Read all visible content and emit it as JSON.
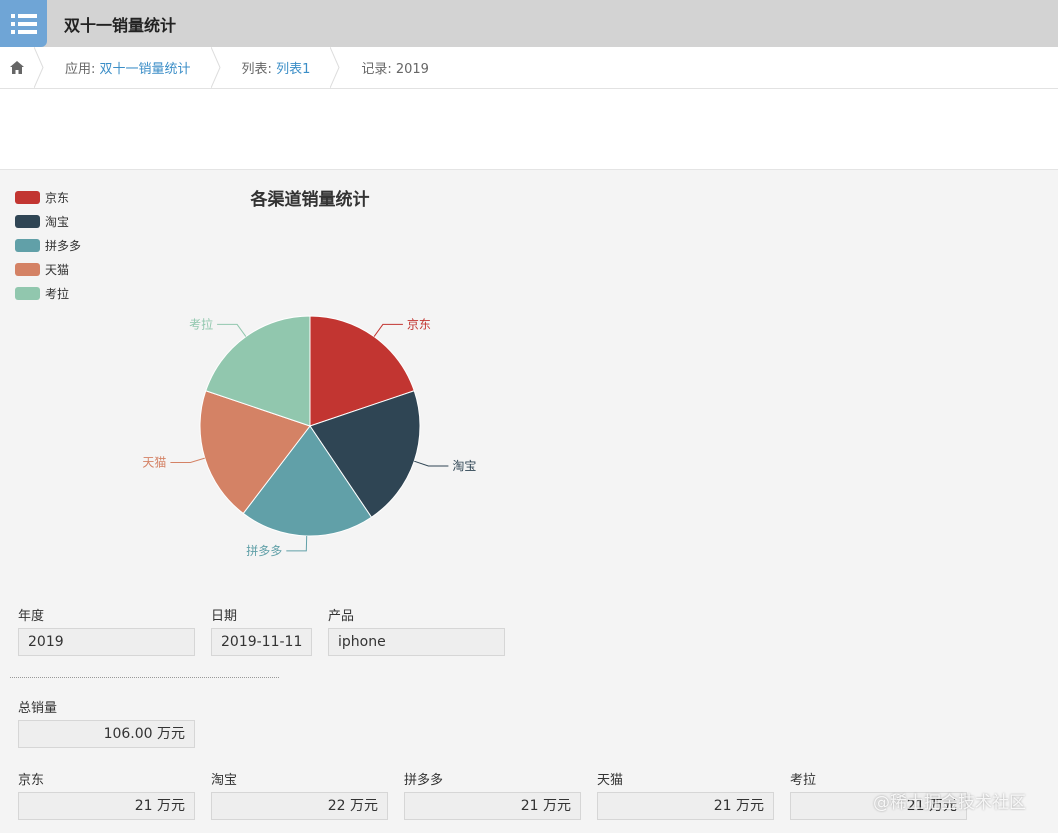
{
  "header": {
    "title": "双十一销量统计",
    "app_icon": "list-icon"
  },
  "breadcrumb": {
    "app_prefix": "应用:",
    "app_name": "双十一销量统计",
    "list_prefix": "列表:",
    "list_name": "列表1",
    "record_label": "记录: 2019"
  },
  "colors": {
    "jd": "#c23531",
    "taobao": "#2f4554",
    "pdd": "#61a0a8",
    "tmall": "#d48265",
    "kaola": "#91c7ae",
    "link": "#3b8ec7"
  },
  "chart_data": {
    "type": "pie",
    "title": "各渠道销量统计",
    "categories": [
      "京东",
      "淘宝",
      "拼多多",
      "天猫",
      "考拉"
    ],
    "values": [
      21,
      22,
      21,
      21,
      21
    ],
    "colors": [
      "#c23531",
      "#2f4554",
      "#61a0a8",
      "#d48265",
      "#91c7ae"
    ],
    "legend": "top-left"
  },
  "form": {
    "year_label": "年度",
    "year_value": "2019",
    "date_label": "日期",
    "date_value": "2019-11-11",
    "product_label": "产品",
    "product_value": "iphone",
    "total_label": "总销量",
    "total_value": "106.00 万元",
    "channels": [
      {
        "label": "京东",
        "value": "21 万元"
      },
      {
        "label": "淘宝",
        "value": "22 万元"
      },
      {
        "label": "拼多多",
        "value": "21 万元"
      },
      {
        "label": "天猫",
        "value": "21 万元"
      },
      {
        "label": "考拉",
        "value": "21 万元"
      }
    ]
  },
  "watermark": "@稀土掘金技术社区"
}
